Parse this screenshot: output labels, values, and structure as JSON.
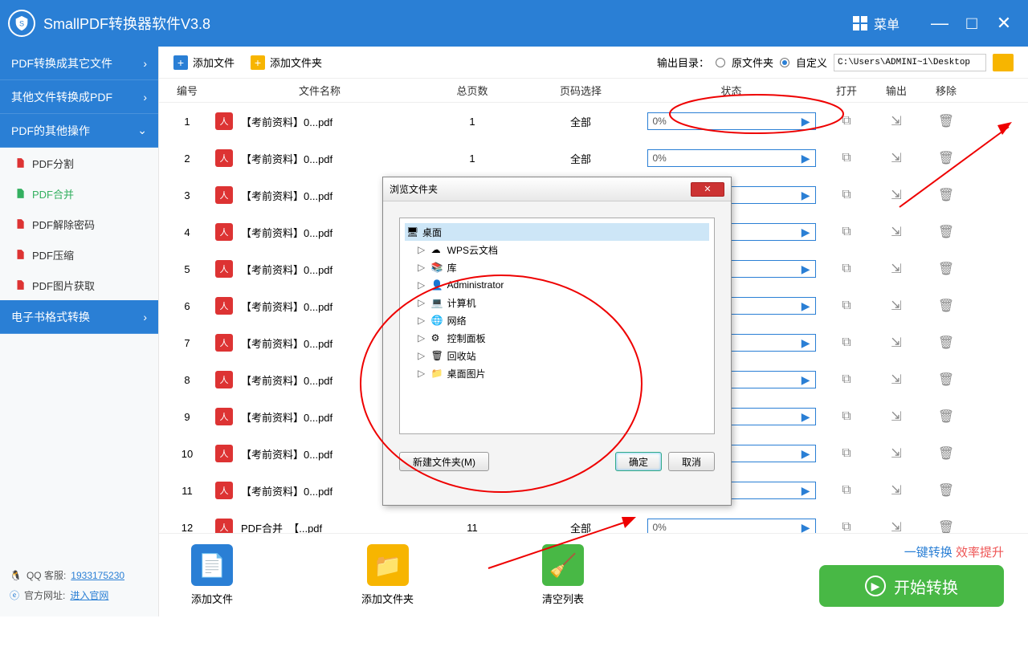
{
  "app": {
    "title": "SmallPDF转换器软件V3.8",
    "menu": "菜单"
  },
  "sidebar": {
    "groups": [
      {
        "label": "PDF转换成其它文件"
      },
      {
        "label": "其他文件转换成PDF"
      },
      {
        "label": "PDF的其他操作"
      },
      {
        "label": "电子书格式转换"
      }
    ],
    "items": [
      {
        "label": "PDF分割"
      },
      {
        "label": "PDF合并"
      },
      {
        "label": "PDF解除密码"
      },
      {
        "label": "PDF压缩"
      },
      {
        "label": "PDF图片获取"
      }
    ],
    "footer": {
      "qq_label": "QQ 客服:",
      "qq": "1933175230",
      "site_label": "官方网址:",
      "site": "进入官网"
    }
  },
  "toolbar": {
    "add_file": "添加文件",
    "add_folder": "添加文件夹",
    "outdir_label": "输出目录：",
    "radio_source": "原文件夹",
    "radio_custom": "自定义",
    "path": "C:\\Users\\ADMINI~1\\Desktop"
  },
  "table": {
    "headers": {
      "num": "编号",
      "name": "文件名称",
      "pages": "总页数",
      "psel": "页码选择",
      "status": "状态",
      "open": "打开",
      "out": "输出",
      "del": "移除"
    },
    "rows": [
      {
        "n": "1",
        "name": "【考前资料】0...pdf",
        "pages": "1",
        "psel": "全部",
        "pct": "0%"
      },
      {
        "n": "2",
        "name": "【考前资料】0...pdf",
        "pages": "1",
        "psel": "全部",
        "pct": "0%"
      },
      {
        "n": "3",
        "name": "【考前资料】0...pdf",
        "pages": "",
        "psel": "",
        "pct": ""
      },
      {
        "n": "4",
        "name": "【考前资料】0...pdf",
        "pages": "",
        "psel": "",
        "pct": ""
      },
      {
        "n": "5",
        "name": "【考前资料】0...pdf",
        "pages": "",
        "psel": "",
        "pct": ""
      },
      {
        "n": "6",
        "name": "【考前资料】0...pdf",
        "pages": "",
        "psel": "",
        "pct": ""
      },
      {
        "n": "7",
        "name": "【考前资料】0...pdf",
        "pages": "",
        "psel": "",
        "pct": ""
      },
      {
        "n": "8",
        "name": "【考前资料】0...pdf",
        "pages": "",
        "psel": "",
        "pct": ""
      },
      {
        "n": "9",
        "name": "【考前资料】0...pdf",
        "pages": "",
        "psel": "",
        "pct": ""
      },
      {
        "n": "10",
        "name": "【考前资料】0...pdf",
        "pages": "",
        "psel": "",
        "pct": ""
      },
      {
        "n": "11",
        "name": "【考前资料】0...pdf",
        "pages": "",
        "psel": "",
        "pct": ""
      },
      {
        "n": "12",
        "name": "PDF合并_【...pdf",
        "pages": "11",
        "psel": "全部",
        "pct": "0%"
      }
    ]
  },
  "bottom": {
    "add_file": "添加文件",
    "add_folder": "添加文件夹",
    "clear": "清空列表",
    "promo1": "一键转换",
    "promo2": "效率提升",
    "start": "开始转换"
  },
  "dialog": {
    "title": "浏览文件夹",
    "tree": [
      {
        "label": "桌面",
        "sel": true
      },
      {
        "label": "WPS云文档"
      },
      {
        "label": "库"
      },
      {
        "label": "Administrator"
      },
      {
        "label": "计算机"
      },
      {
        "label": "网络"
      },
      {
        "label": "控制面板"
      },
      {
        "label": "回收站"
      },
      {
        "label": "桌面图片"
      }
    ],
    "new_folder": "新建文件夹(M)",
    "ok": "确定",
    "cancel": "取消"
  }
}
